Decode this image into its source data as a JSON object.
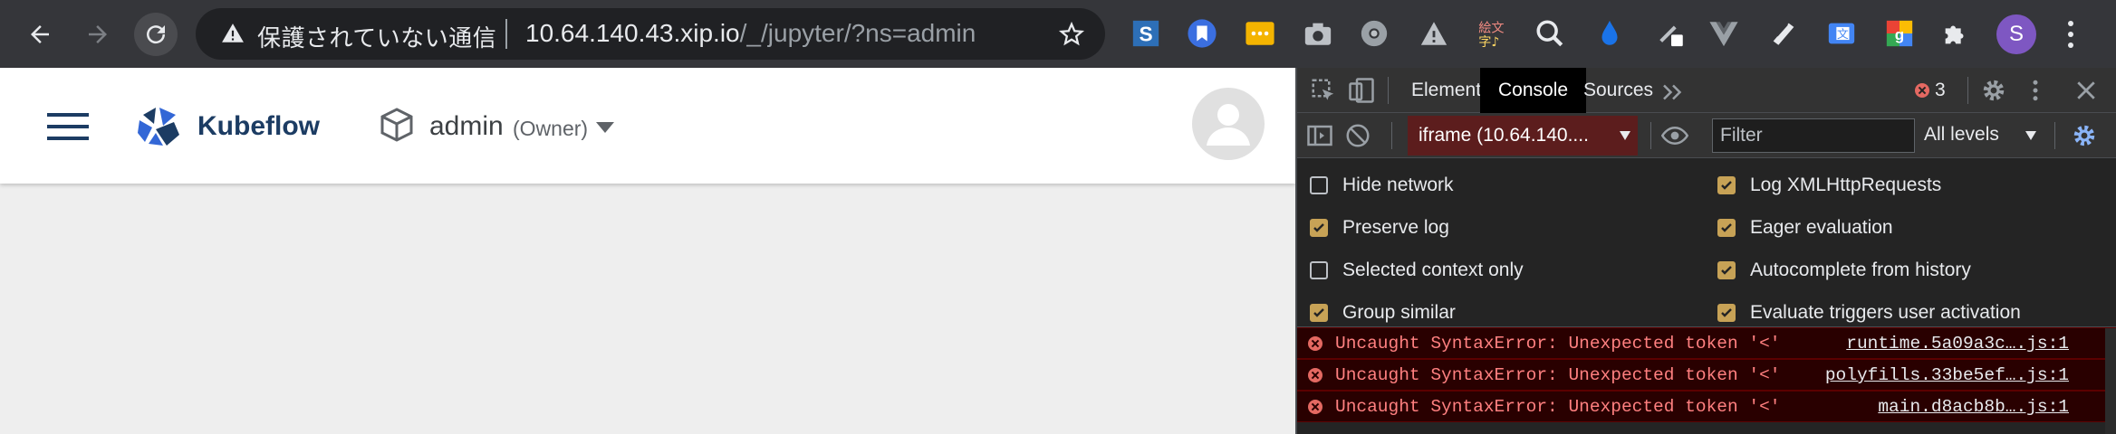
{
  "browser": {
    "omnibox": {
      "warning": "保護されていない通信",
      "host": "10.64.140.43.xip.io",
      "path": "/_/jupyter/?ns=admin"
    },
    "profile_initial": "S",
    "extensions": [
      "s-extension-icon",
      "bookmark-extension-icon",
      "dots-extension-icon",
      "camera-extension-icon",
      "chrome-extension-icon",
      "warning-extension-icon",
      "emoji-extension-icon",
      "magnifier-extension-icon",
      "drop-extension-icon",
      "pen-extension-icon",
      "vue-extension-icon",
      "note-extension-icon",
      "translate-extension-icon",
      "google-extension-icon",
      "puzzle-extension-icon"
    ]
  },
  "kubeflow": {
    "brand": "Kubeflow",
    "namespace": "admin",
    "role": "(Owner)"
  },
  "devtools": {
    "tabs": [
      "Elements",
      "Console",
      "Sources"
    ],
    "active_tab": "Console",
    "error_count": "3",
    "context": "iframe (10.64.140....",
    "filter_placeholder": "Filter",
    "levels": "All levels",
    "settings_left": [
      {
        "label": "Hide network",
        "checked": false
      },
      {
        "label": "Preserve log",
        "checked": true
      },
      {
        "label": "Selected context only",
        "checked": false
      },
      {
        "label": "Group similar",
        "checked": true
      }
    ],
    "settings_right": [
      {
        "label": "Log XMLHttpRequests",
        "checked": true
      },
      {
        "label": "Eager evaluation",
        "checked": true
      },
      {
        "label": "Autocomplete from history",
        "checked": true
      },
      {
        "label": "Evaluate triggers user activation",
        "checked": true
      }
    ],
    "console_errors": [
      {
        "message": "Uncaught SyntaxError: Unexpected token '<'",
        "source": "runtime.5a09a3c….js:1"
      },
      {
        "message": "Uncaught SyntaxError: Unexpected token '<'",
        "source": "polyfills.33be5ef….js:1"
      },
      {
        "message": "Uncaught SyntaxError: Unexpected token '<'",
        "source": "main.d8acb8b….js:1"
      }
    ]
  },
  "colors": {
    "accent_blue": "#8ab4f8",
    "kubeflow_navy": "#1c3c63",
    "checkbox_gold": "#c7a256",
    "error_red": "#e46962"
  }
}
